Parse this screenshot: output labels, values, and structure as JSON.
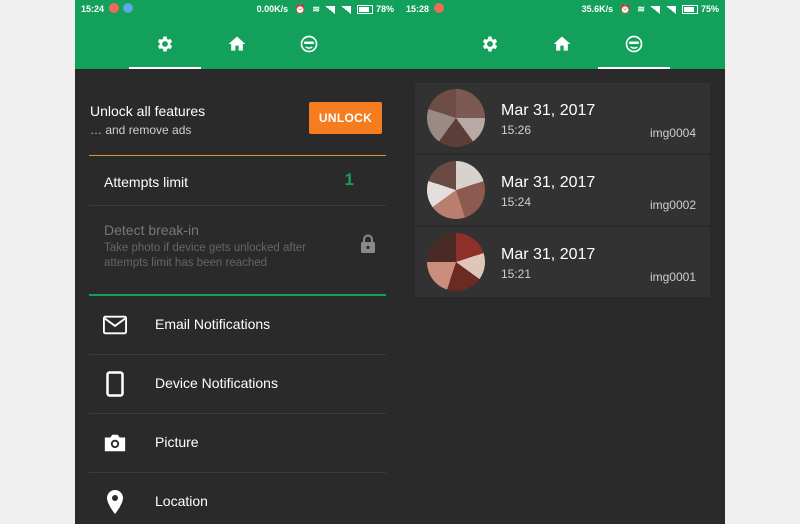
{
  "left_status": {
    "time": "15:24",
    "speed": "0.00K/s",
    "battery": "78%"
  },
  "right_status": {
    "time": "15:28",
    "speed": "35.6K/s",
    "battery": "75%"
  },
  "tabs": [
    {
      "icon": "gear-icon"
    },
    {
      "icon": "home-icon"
    },
    {
      "icon": "sneaky-face-icon"
    }
  ],
  "settings": {
    "unlock_title": "Unlock all features",
    "unlock_subtitle": "… and remove ads",
    "unlock_button": "UNLOCK",
    "attempts_label": "Attempts limit",
    "attempts_value": "1",
    "detect_title": "Detect break-in",
    "detect_subtitle": "Take photo if device gets unlocked after attempts limit has been reached",
    "menu": [
      {
        "label": "Email Notifications",
        "icon": "mail-icon"
      },
      {
        "label": "Device Notifications",
        "icon": "phone-icon"
      },
      {
        "label": "Picture",
        "icon": "camera-icon"
      },
      {
        "label": "Location",
        "icon": "location-pin-icon"
      }
    ]
  },
  "pictures": [
    {
      "date": "Mar 31, 2017",
      "time": "15:26",
      "name": "img0004"
    },
    {
      "date": "Mar 31, 2017",
      "time": "15:24",
      "name": "img0002"
    },
    {
      "date": "Mar 31, 2017",
      "time": "15:21",
      "name": "img0001"
    }
  ],
  "colors": {
    "accent_green": "#12a05a",
    "unlock_orange": "#f57c1f",
    "background_dark": "#2a2a2a"
  }
}
